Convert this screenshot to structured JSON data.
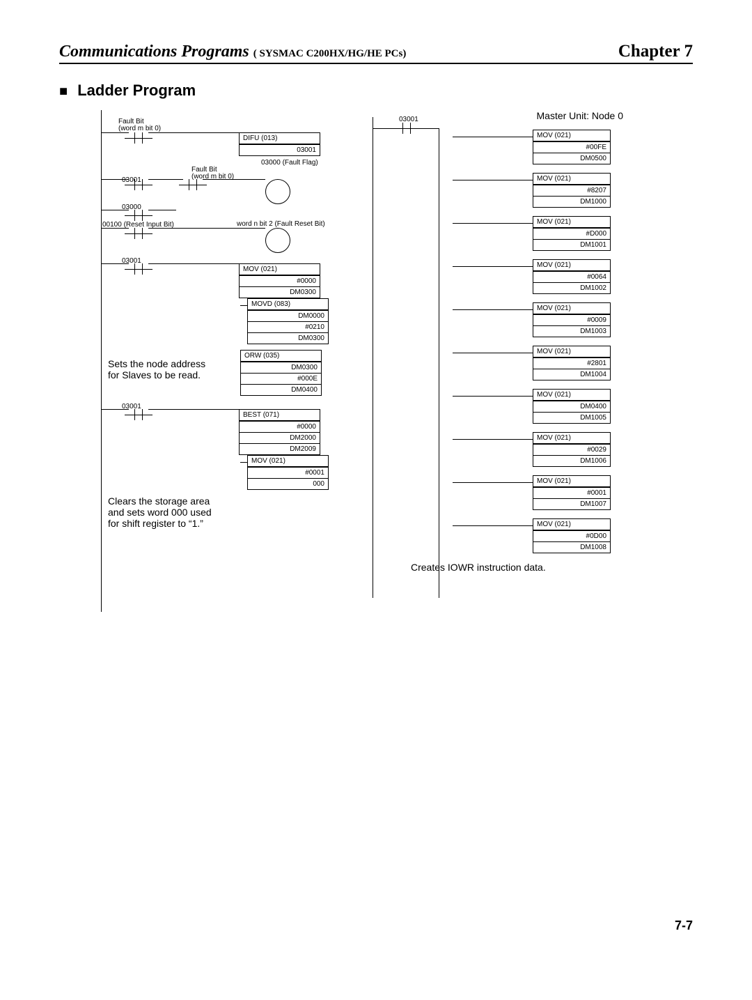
{
  "header": {
    "title_main": "Communications Programs",
    "title_sub": " SYSMAC C200HX/HG/HE PCs)",
    "title_sub_prefix": "(",
    "chapter": "Chapter 7"
  },
  "section": {
    "bullet": "■",
    "title": "Ladder Program"
  },
  "left": {
    "fault_bit_label": "Fault Bit\n(word m bit 0)",
    "difu": {
      "name": "DIFU (013)",
      "rows": [
        "03001"
      ]
    },
    "fault_flag": "03000 (Fault Flag)",
    "addr_03001": "03001",
    "addr_03000": "03000",
    "reset_input": "00100 (Reset Input Bit)",
    "fault_reset": "word n bit 2 (Fault Reset Bit)",
    "mov1": {
      "name": "MOV (021)",
      "rows": [
        "#0000",
        "DM0300"
      ]
    },
    "movd": {
      "name": "MOVD (083)",
      "rows": [
        "DM0000",
        "#0210",
        "DM0300"
      ]
    },
    "orw": {
      "name": "ORW (035)",
      "rows": [
        "DM0300",
        "#000E",
        "DM0400"
      ]
    },
    "note1": "Sets the node address\nfor Slaves to be read.",
    "best": {
      "name": "BEST (071)",
      "rows": [
        "#0000",
        "DM2000",
        "DM2009"
      ]
    },
    "mov2": {
      "name": "MOV (021)",
      "rows": [
        "#0001",
        "000"
      ]
    },
    "note2": "Clears the storage area\nand sets word 000 used\nfor shift register to “1.”"
  },
  "right": {
    "header": "Master Unit: Node 0",
    "top_addr": "03001",
    "items": [
      {
        "name": "MOV (021)",
        "rows": [
          "#00FE",
          "DM0500"
        ]
      },
      {
        "name": "MOV (021)",
        "rows": [
          "#8207",
          "DM1000"
        ]
      },
      {
        "name": "MOV (021)",
        "rows": [
          "#D000",
          "DM1001"
        ]
      },
      {
        "name": "MOV (021)",
        "rows": [
          "#0064",
          "DM1002"
        ]
      },
      {
        "name": "MOV (021)",
        "rows": [
          "#0009",
          "DM1003"
        ]
      },
      {
        "name": "MOV (021)",
        "rows": [
          "#2801",
          "DM1004"
        ]
      },
      {
        "name": "MOV (021)",
        "rows": [
          "DM0400",
          "DM1005"
        ]
      },
      {
        "name": "MOV (021)",
        "rows": [
          "#0029",
          "DM1006"
        ]
      },
      {
        "name": "MOV (021)",
        "rows": [
          "#0001",
          "DM1007"
        ]
      },
      {
        "name": "MOV (021)",
        "rows": [
          "#0D00",
          "DM1008"
        ]
      }
    ],
    "caption": "Creates IOWR instruction data."
  },
  "footer": {
    "page": "7-7"
  }
}
